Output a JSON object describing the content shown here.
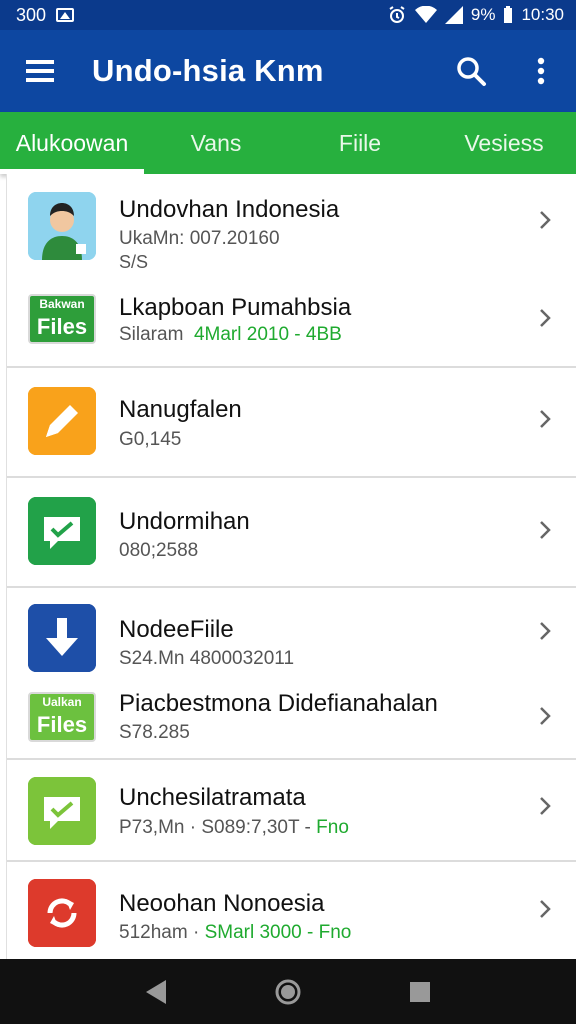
{
  "status_bar": {
    "left_text": "300",
    "time": "10:30",
    "battery": "9%"
  },
  "app_bar": {
    "title": "Undo-hsia Knm"
  },
  "tabs": [
    {
      "label": "Alukoowan",
      "active": true
    },
    {
      "label": "Vans",
      "active": false
    },
    {
      "label": "Fiile",
      "active": false
    },
    {
      "label": "Vesiess",
      "active": false
    }
  ],
  "items": [
    {
      "title": "Undovhan Indonesia",
      "sub": "UkaMn: 007.20160",
      "sub2": "S/S",
      "icon": "person-avatar-icon"
    },
    {
      "title": "Lkapboan Pumahbsia",
      "sub_gray": "Silaram",
      "sub_green": "4Marl 2010 - 4BB",
      "icon": "files-icon",
      "icon_top": "Bakwan",
      "icon_text": "Files"
    },
    {
      "title": "Nanugfalen",
      "sub": "G0,145",
      "icon": "pencil-icon"
    },
    {
      "title": "Undormihan",
      "sub": "080;2588",
      "icon": "chat-check-icon"
    },
    {
      "title": "NodeeFiile",
      "sub": "S24.Mn 4800032011",
      "icon": "download-icon"
    },
    {
      "title": "Piacbestmona Didefianahalan",
      "sub": "S78.285",
      "icon": "files-icon",
      "icon_top": "Ualkan",
      "icon_text": "Files"
    },
    {
      "title": "Unchesilatramata",
      "sub_gray": "P73,Mn · S089:7,30T -",
      "sub_green": "Fno",
      "icon": "chat-check-icon"
    },
    {
      "title": "Neoohan Nonoesia",
      "sub_gray": "512ham ·",
      "sub_green": "SMarl 3000 - Fno",
      "icon": "sync-icon"
    }
  ]
}
